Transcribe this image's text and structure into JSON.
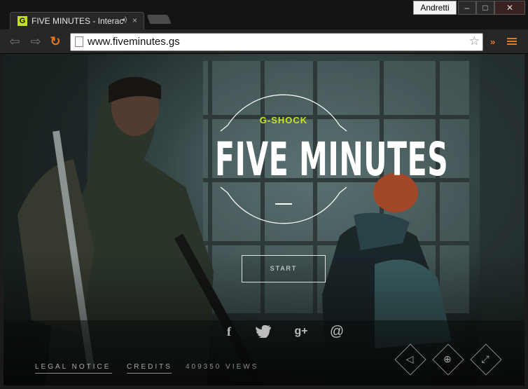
{
  "browser": {
    "user_name": "Andretti",
    "controls": {
      "minimize": "–",
      "maximize": "□",
      "close": "✕"
    },
    "tab": {
      "favicon": "G",
      "title": "FIVE MINUTES - Interac",
      "audio_icon": "◂)",
      "close": "×"
    },
    "nav": {
      "back": "⇦",
      "forward": "⇨",
      "reload": "↻"
    },
    "url": "www.fiveminutes.gs",
    "star": "☆",
    "extensions": "»"
  },
  "site": {
    "brand": "G-SHOCK",
    "title": "FIVE MINUTES",
    "start_label": "START",
    "social": {
      "facebook": "f",
      "twitter": "🐦",
      "googleplus": "g+",
      "email": "@"
    },
    "footer": {
      "legal": "LEGAL NOTICE",
      "credits": "CREDITS",
      "views": "409350 VIEWS"
    },
    "controls": {
      "sound": "◁",
      "language": "⊕",
      "fullscreen": "⤢"
    }
  }
}
